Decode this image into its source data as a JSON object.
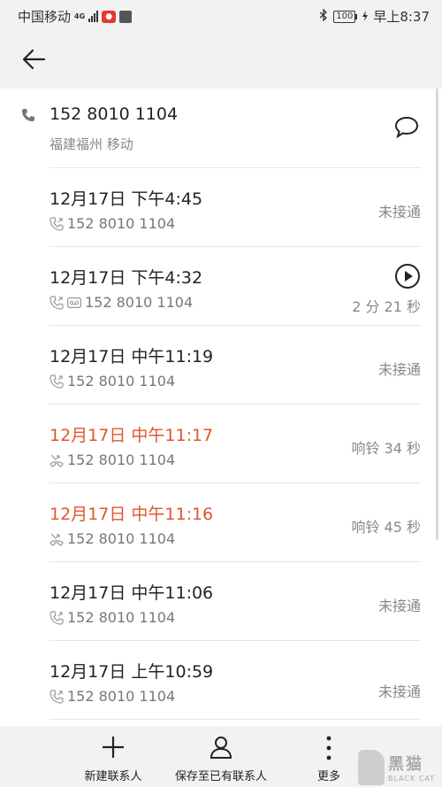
{
  "status_bar": {
    "carrier": "中国移动",
    "network": "4G",
    "battery": "100",
    "time": "早上8:37"
  },
  "contact": {
    "number": "152 8010 1104",
    "location": "福建福州 移动"
  },
  "calls": [
    {
      "time": "12月17日 下午4:45",
      "number": "152 8010 1104",
      "status": "未接通",
      "missed": false,
      "voicemail": false
    },
    {
      "time": "12月17日 下午4:32",
      "number": "152 8010 1104",
      "status": "2 分 21 秒",
      "missed": false,
      "voicemail": true
    },
    {
      "time": "12月17日 中午11:19",
      "number": "152 8010 1104",
      "status": "未接通",
      "missed": false,
      "voicemail": false
    },
    {
      "time": "12月17日 中午11:17",
      "number": "152 8010 1104",
      "status": "响铃 34 秒",
      "missed": true,
      "voicemail": false
    },
    {
      "time": "12月17日 中午11:16",
      "number": "152 8010 1104",
      "status": "响铃 45 秒",
      "missed": true,
      "voicemail": false
    },
    {
      "time": "12月17日 中午11:06",
      "number": "152 8010 1104",
      "status": "未接通",
      "missed": false,
      "voicemail": false
    },
    {
      "time": "12月17日 上午10:59",
      "number": "152 8010 1104",
      "status": "未接通",
      "missed": false,
      "voicemail": false
    }
  ],
  "toolbar": {
    "new_contact": "新建联系人",
    "save_existing": "保存至已有联系人",
    "more": "更多"
  },
  "watermark": {
    "brand_cn": "黑猫",
    "brand_en": "BLACK CAT"
  },
  "colors": {
    "missed": "#e0552f",
    "secondary_text": "#888888"
  }
}
